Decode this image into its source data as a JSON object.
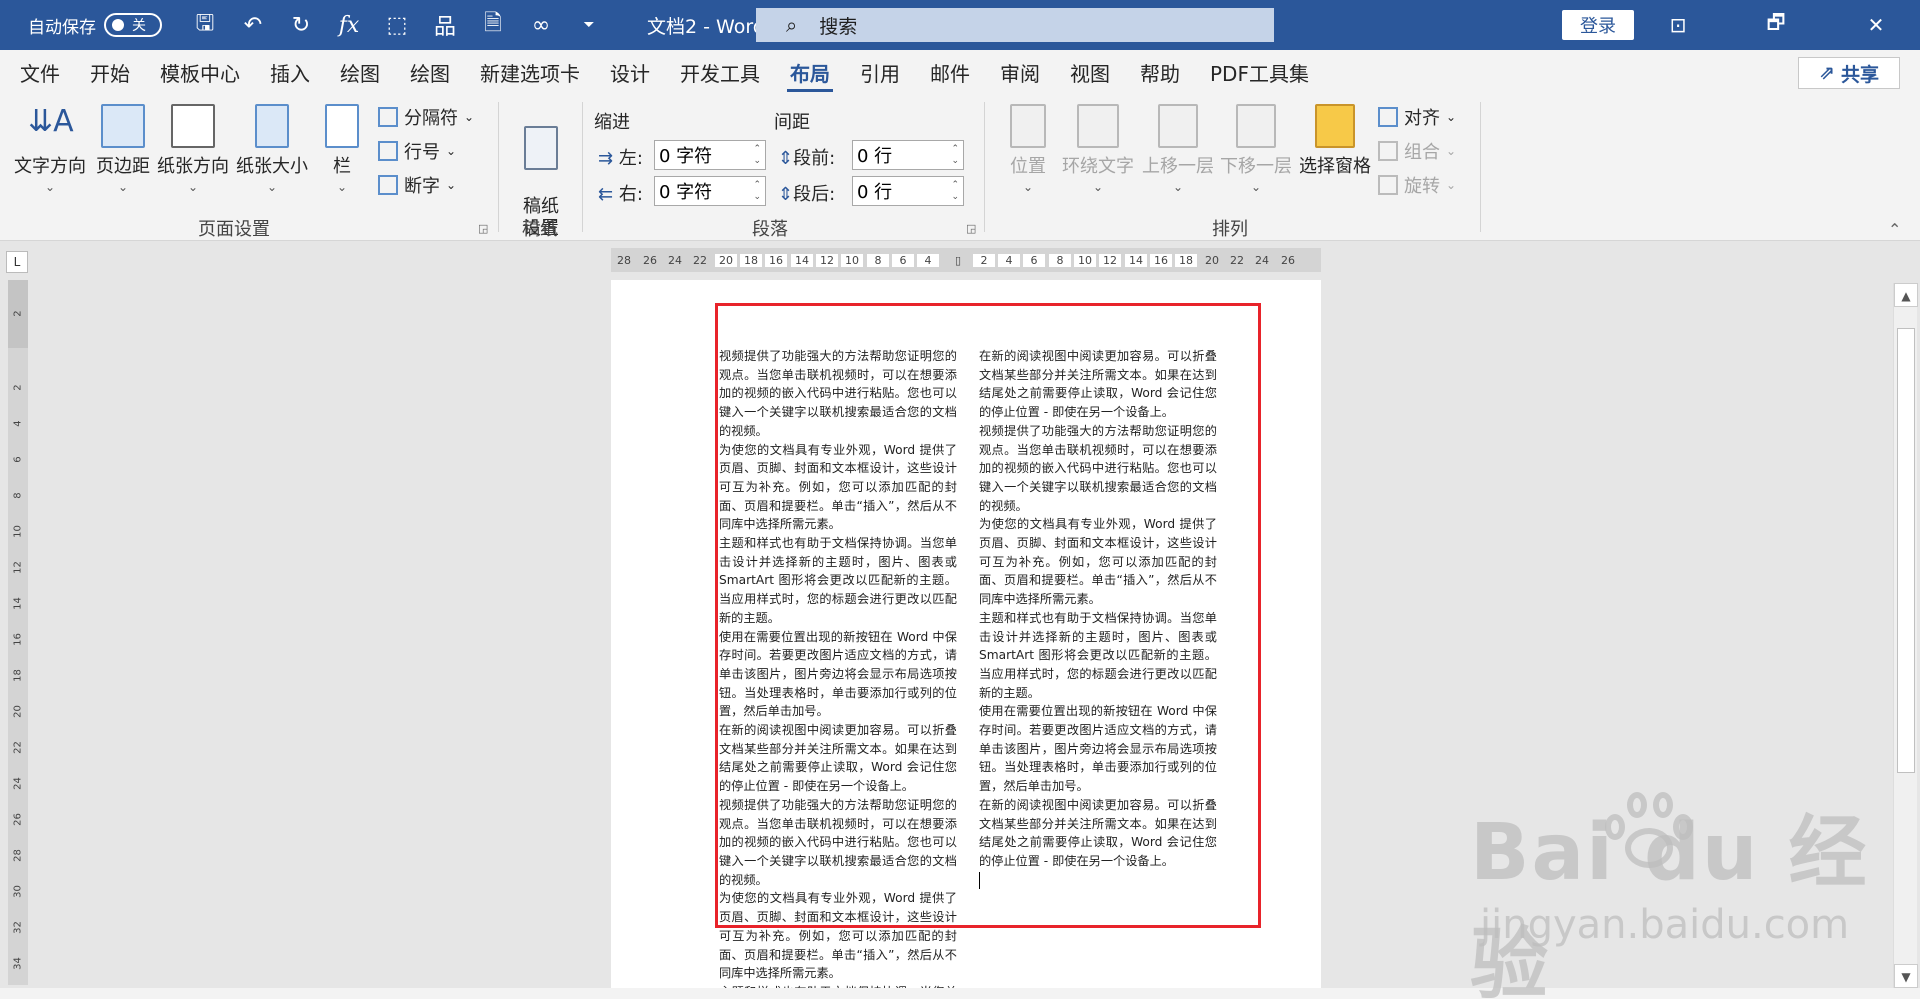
{
  "titlebar": {
    "autosave_label": "自动保存",
    "toggle_state": "关",
    "doc_title": "文档2 - Word",
    "search_placeholder": "搜索",
    "login_label": "登录",
    "qat_icons": [
      "save-icon",
      "undo-icon",
      "redo-icon",
      "fx-icon",
      "select-icon",
      "hierarchy-icon",
      "doc-icon",
      "infinity-icon",
      "customize-icon"
    ],
    "qat_glyphs": [
      "🖫",
      "↶",
      "↻",
      "fx",
      "⬚",
      "品",
      "🗎",
      "∞",
      "⏷"
    ],
    "window_buttons": [
      "⊡",
      "🗗",
      "✕"
    ],
    "accent_color": "#2b579a"
  },
  "tabs": {
    "items": [
      "文件",
      "开始",
      "模板中心",
      "插入",
      "绘图",
      "绘图",
      "新建选项卡",
      "设计",
      "开发工具",
      "布局",
      "引用",
      "邮件",
      "审阅",
      "视图",
      "帮助",
      "PDF工具集"
    ],
    "active": "布局",
    "share_label": "共享"
  },
  "ribbon": {
    "page_setup": {
      "label": "页面设置",
      "text_direction": "文字方向",
      "margins": "页边距",
      "orientation": "纸张方向",
      "size": "纸张大小",
      "columns": "栏",
      "breaks": "分隔符",
      "line_numbers": "行号",
      "hyphenation": "断字"
    },
    "manuscript": {
      "label": "稿纸",
      "button": "稿纸\n设置"
    },
    "paragraph": {
      "label": "段落",
      "indent_title": "缩进",
      "spacing_title": "间距",
      "left_label": "左:",
      "right_label": "右:",
      "before_label": "段前:",
      "after_label": "段后:",
      "left_value": "0 字符",
      "right_value": "0 字符",
      "before_value": "0 行",
      "after_value": "0 行"
    },
    "arrange": {
      "label": "排列",
      "position": "位置",
      "wrap_text": "环绕文字",
      "bring_forward": "上移一层",
      "send_backward": "下移一层",
      "selection_pane": "选择窗格",
      "align": "对齐",
      "group": "组合",
      "rotate": "旋转"
    }
  },
  "ruler": {
    "left_ticks": [
      "28",
      "26",
      "24",
      "22",
      "20",
      "18",
      "16",
      "14",
      "12",
      "10",
      "8",
      "6",
      "4"
    ],
    "right_ticks": [
      "2",
      "4",
      "6",
      "8",
      "10",
      "12",
      "14",
      "16",
      "18",
      "20",
      "22",
      "24",
      "26"
    ],
    "vertical_ticks": [
      "2",
      "2",
      "4",
      "6",
      "8",
      "10",
      "12",
      "14",
      "16",
      "18",
      "20",
      "22",
      "24",
      "26",
      "28",
      "30",
      "32",
      "34"
    ]
  },
  "document": {
    "col1": [
      "视频提供了功能强大的方法帮助您证明您的观点。当您单击联机视频时，可以在想要添加的视频的嵌入代码中进行粘贴。您也可以键入一个关键字以联机搜索最适合您的文档的视频。",
      "为使您的文档具有专业外观，Word 提供了页眉、页脚、封面和文本框设计，这些设计可互为补充。例如，您可以添加匹配的封面、页眉和提要栏。单击“插入”，然后从不同库中选择所需元素。",
      "主题和样式也有助于文档保持协调。当您单击设计并选择新的主题时，图片、图表或 SmartArt 图形将会更改以匹配新的主题。当应用样式时，您的标题会进行更改以匹配新的主题。",
      "使用在需要位置出现的新按钮在 Word 中保存时间。若要更改图片适应文档的方式，请单击该图片，图片旁边将会显示布局选项按钮。当处理表格时，单击要添加行或列的位置，然后单击加号。",
      "在新的阅读视图中阅读更加容易。可以折叠文档某些部分并关注所需文本。如果在达到结尾处之前需要停止读取，Word 会记住您的停止位置 - 即使在另一个设备上。",
      "视频提供了功能强大的方法帮助您证明您的观点。当您单击联机视频时，可以在想要添加的视频的嵌入代码中进行粘贴。您也可以键入一个关键字以联机搜索最适合您的文档的视频。",
      "为使您的文档具有专业外观，Word 提供了页眉、页脚、封面和文本框设计，这些设计可互为补充。例如，您可以添加匹配的封面、页眉和提要栏。单击“插入”，然后从不同库中选择所需元素。",
      "主题和样式也有助于文档保持协调。当您单击设计并选择新的主题时，图片、图表或"
    ],
    "col2": [
      "在新的阅读视图中阅读更加容易。可以折叠文档某些部分并关注所需文本。如果在达到结尾处之前需要停止读取，Word 会记住您的停止位置 - 即使在另一个设备上。",
      "视频提供了功能强大的方法帮助您证明您的观点。当您单击联机视频时，可以在想要添加的视频的嵌入代码中进行粘贴。您也可以键入一个关键字以联机搜索最适合您的文档的视频。",
      "为使您的文档具有专业外观，Word 提供了页眉、页脚、封面和文本框设计，这些设计可互为补充。例如，您可以添加匹配的封面、页眉和提要栏。单击“插入”，然后从不同库中选择所需元素。",
      "主题和样式也有助于文档保持协调。当您单击设计并选择新的主题时，图片、图表或 SmartArt 图形将会更改以匹配新的主题。当应用样式时，您的标题会进行更改以匹配新的主题。",
      "使用在需要位置出现的新按钮在 Word 中保存时间。若要更改图片适应文档的方式，请单击该图片，图片旁边将会显示布局选项按钮。当处理表格时，单击要添加行或列的位置，然后单击加号。",
      "在新的阅读视图中阅读更加容易。可以折叠文档某些部分并关注所需文本。如果在达到结尾处之前需要停止读取，Word 会记住您的停止位置 - 即使在另一个设备上。"
    ],
    "highlight_color": "#e8232a"
  },
  "watermark": {
    "brand": "Bai du 经验",
    "url": "jingyan.baidu.com"
  }
}
